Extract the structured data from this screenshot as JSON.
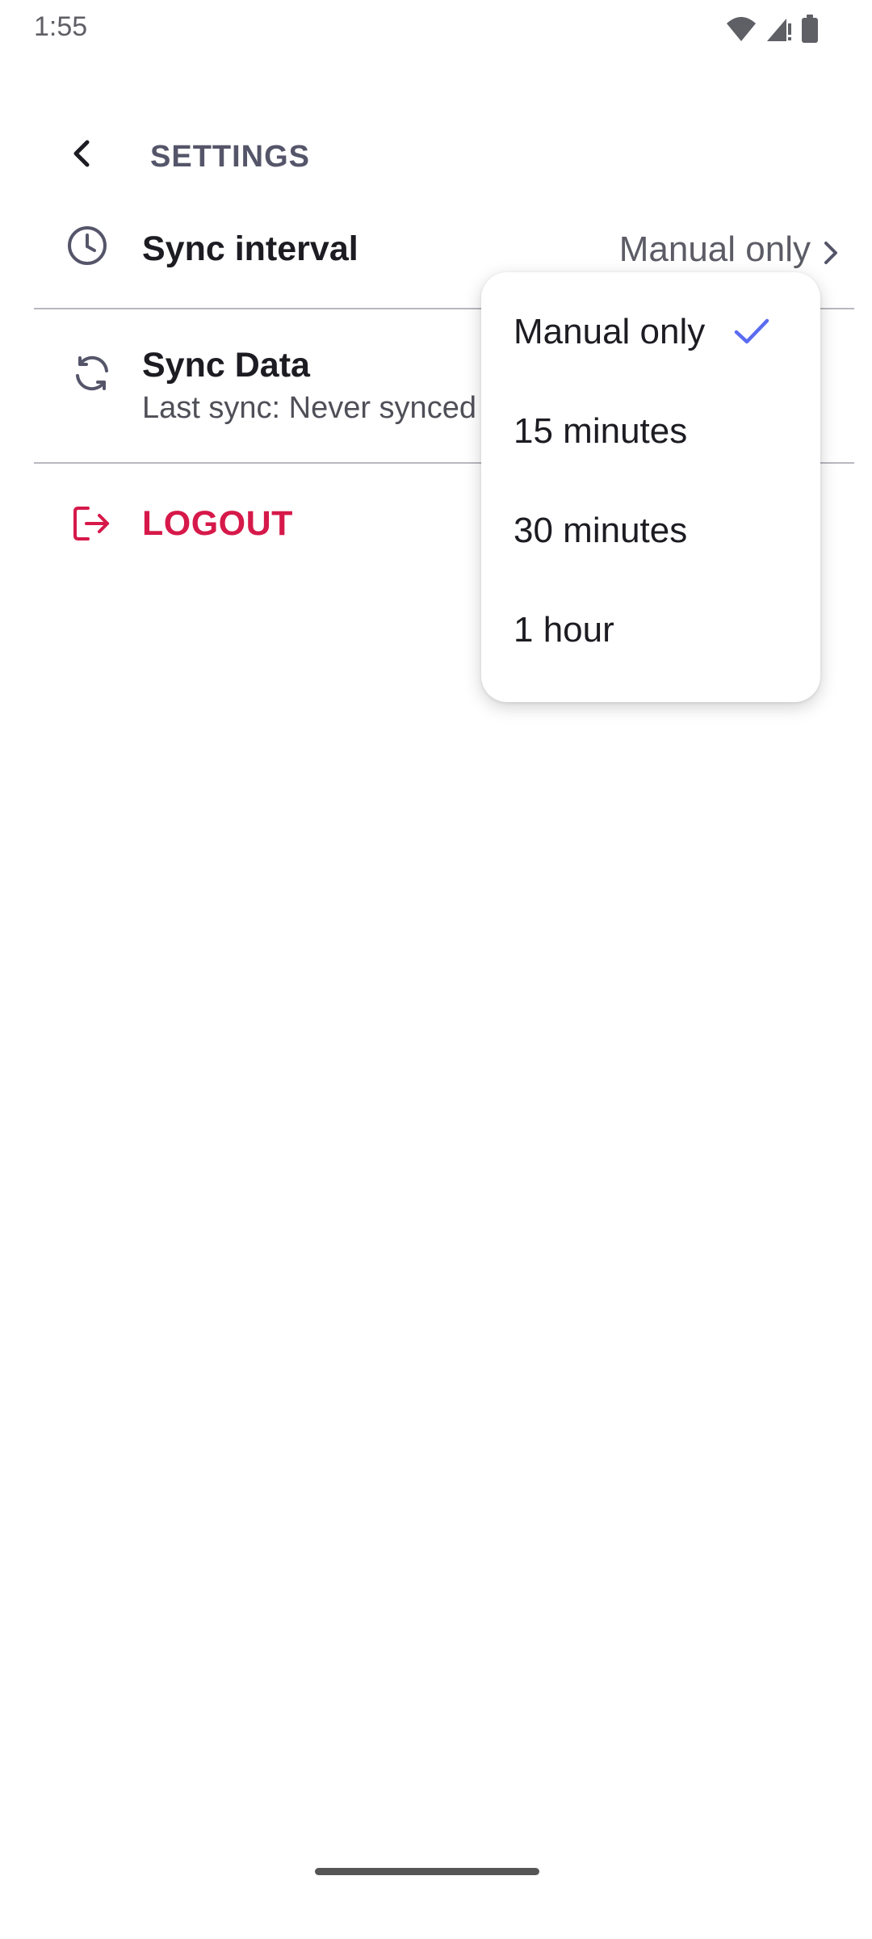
{
  "status_bar": {
    "time": "1:55"
  },
  "header": {
    "title": "SETTINGS"
  },
  "settings": {
    "sync_interval": {
      "label": "Sync interval",
      "value": "Manual only"
    },
    "sync_data": {
      "label": "Sync Data",
      "subtitle": "Last sync: Never synced"
    },
    "logout": {
      "label": "LOGOUT"
    }
  },
  "dropdown": {
    "options": [
      {
        "label": "Manual only",
        "selected": true
      },
      {
        "label": "15 minutes",
        "selected": false
      },
      {
        "label": "30 minutes",
        "selected": false
      },
      {
        "label": "1 hour",
        "selected": false
      }
    ]
  },
  "colors": {
    "accent": "#5b6cf0",
    "logout": "#d6194a",
    "title": "#55556a",
    "divider": "#b8b8c0"
  }
}
